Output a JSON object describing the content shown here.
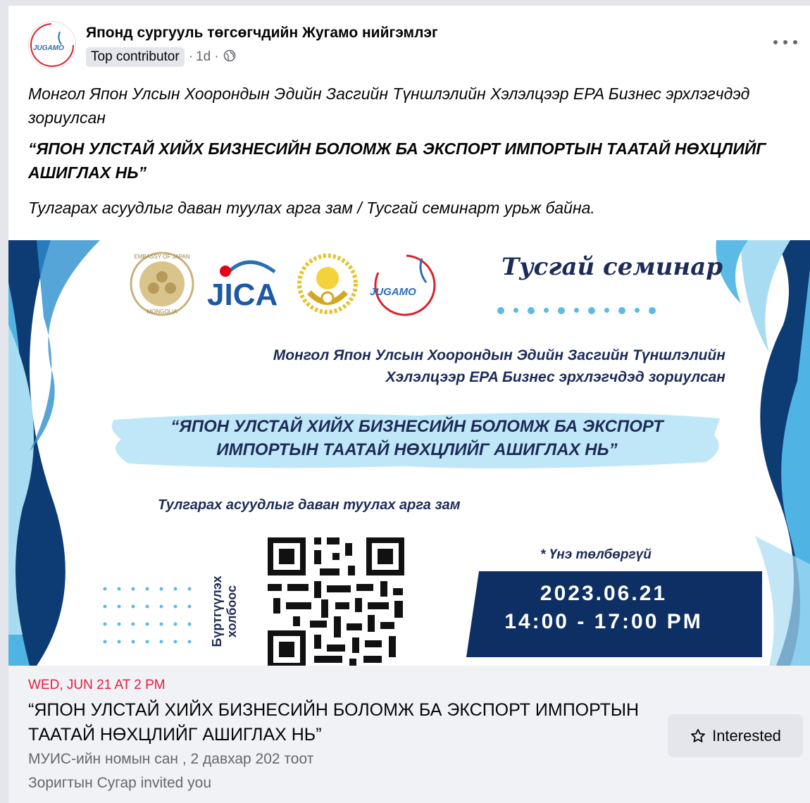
{
  "post": {
    "page_name": "Японд сургууль төгсөгчдийн Жугамо нийгэмлэг",
    "badge": "Top contributor",
    "sep": "·",
    "time": "1d ·",
    "avatar_logo_text": "JUGAMO",
    "text_line1": "Монгол Япон Улсын Хоорондын Эдийн Засгийн Түншлэлийн Хэлэлцээр EPA Бизнес эрхлэгчдэд зориулсан",
    "text_line2": "“ЯПОН УЛСТАЙ ХИЙХ БИЗНЕСИЙН БОЛОМЖ БА ЭКСПОРТ ИМПОРТЫН ТААТАЙ НӨХЦЛИЙГ АШИГЛАХ НЬ”",
    "text_line3": "Тулгарах асуудлыг даван туулах арга зам / Тусгай семинарт урьж байна."
  },
  "poster": {
    "title": "Тусгай семинар",
    "sub_line1": "Монгол Япон Улсын Хоорондын Эдийн Засгийн Түншлэлийн",
    "sub_line2": "Хэлэлцээр EPA Бизнес эрхлэгчдэд зориулсан",
    "head_line1": "“ЯПОН УЛСТАЙ ХИЙХ БИЗНЕСИЙН БОЛОМЖ БА ЭКСПОРТ",
    "head_line2": "ИМПОРТЫН ТААТАЙ НӨХЦЛИЙГ АШИГЛАХ НЬ”",
    "line": "Тулгарах асуудлыг даван туулах арга зам",
    "free": "* Үнэ төлбөргүй",
    "date": "2023.06.21",
    "time": "14:00 - 17:00 PM",
    "reg_line1": "Бүртгүүлэх",
    "reg_line2": "холбоос",
    "logo_jica": "JICA",
    "logo_jugamo": "JUGAMO",
    "logo_embassy_top": "EMBASSY OF JAPAN",
    "logo_embassy_bottom": "MONGOLIA"
  },
  "event": {
    "date": "WED, JUN 21 AT 2 PM",
    "title": "“ЯПОН УЛСТАЙ ХИЙХ БИЗНЕСИЙН БОЛОМЖ БА ЭКСПОРТ ИМПОРТЫН ТААТАЙ НӨХЦЛИЙГ АШИГЛАХ НЬ”",
    "location": "МУИС-ийн номын сан , 2 давхар 202 тоот",
    "invited": "Зоригтын Сугар invited you",
    "interested_label": "Interested"
  },
  "colors": {
    "navy": "#1d2b57",
    "light_blue": "#5bbbe6",
    "accent_red": "#e41e3f",
    "dark_band": "#0e2f63"
  }
}
